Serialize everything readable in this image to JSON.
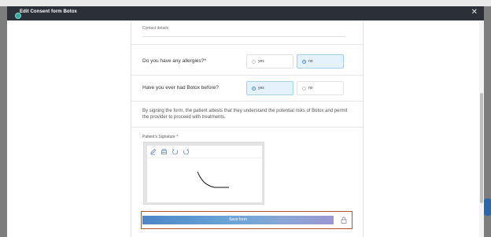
{
  "modal": {
    "title": "Edit Consent form Botox"
  },
  "form": {
    "contact_details_label": "Contact details",
    "questions": [
      {
        "label": "Do you have any allergies?*",
        "options": [
          {
            "label": "yes",
            "selected": false
          },
          {
            "label": "no",
            "selected": true
          }
        ]
      },
      {
        "label": "Have you ever had Botox before?",
        "options": [
          {
            "label": "yes",
            "selected": true
          },
          {
            "label": "no",
            "selected": false
          }
        ]
      }
    ],
    "consent_text": "By signing the form, the patient attests that they understand the potential risks of Botox and permit the provider to proceed with treatments.",
    "signature_label": "Patient's Signature *",
    "save_label": "Save form"
  },
  "colors": {
    "header_bg": "#2b2f38",
    "selected_option_bg": "#e6f2fb",
    "save_button_start": "#4d86c8",
    "save_button_end": "#9b97d0",
    "highlight_border": "#b5512b"
  },
  "icons": {
    "header": "status-dot-icon",
    "close": "close-icon",
    "signature_tools": [
      "pen-icon",
      "eraser-icon",
      "undo-icon",
      "redo-icon"
    ],
    "lock": "lock-icon"
  }
}
